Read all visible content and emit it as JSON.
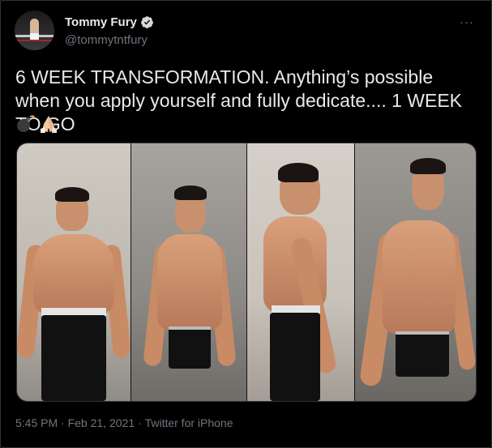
{
  "author": {
    "name": "Tommy Fury",
    "handle": "@tommytntfury",
    "verified_icon": "verified-badge-icon",
    "avatar_icon": "boxer-avatar"
  },
  "menu": {
    "more_label": "···"
  },
  "tweet": {
    "text": "6 WEEK TRANSFORMATION. Anything’s possible when you apply yourself and fully dedicate.... 1 WEEK TO GO",
    "emojis": [
      "💣",
      "🙏🏼"
    ]
  },
  "media": {
    "panels": [
      "before-front",
      "after-front",
      "before-side",
      "after-side"
    ]
  },
  "footer": {
    "time": "5:45 PM",
    "separator1": " · ",
    "date": "Feb 21, 2021",
    "separator2": " · ",
    "source": "Twitter for iPhone"
  },
  "colors": {
    "background": "#000000",
    "primary_text": "#e7e9ea",
    "secondary_text": "#6e767d",
    "verified": "#d9d9d9"
  }
}
